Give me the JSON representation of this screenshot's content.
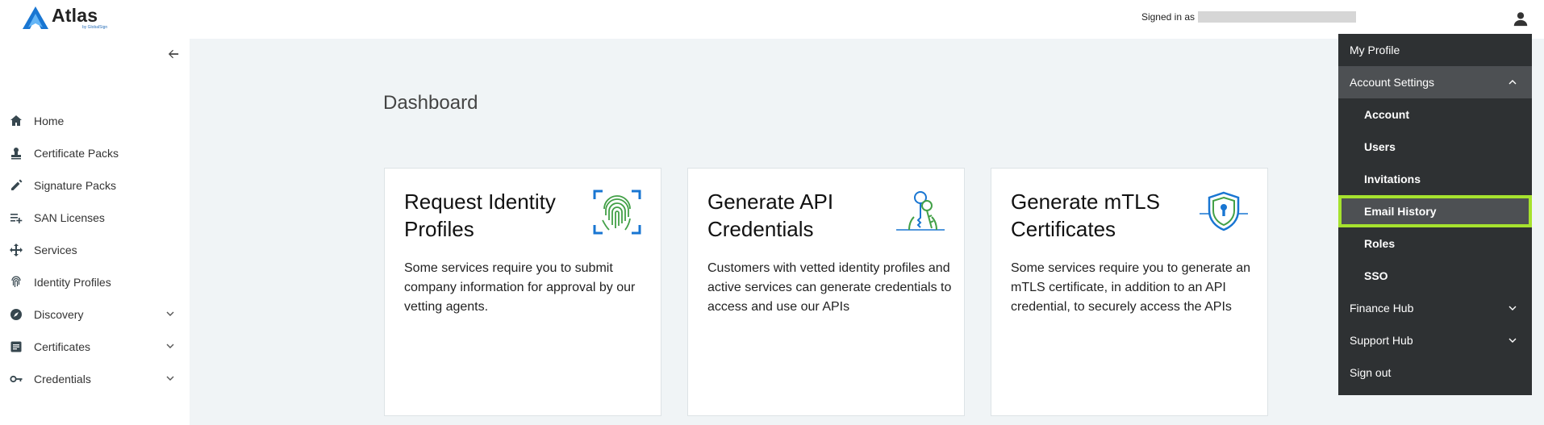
{
  "header": {
    "logo_text": "Atlas",
    "logo_sub": "by GlobalSign",
    "signed_in_label": "Signed in as"
  },
  "sidebar": {
    "items": [
      {
        "label": "Home",
        "icon": "home-icon"
      },
      {
        "label": "Certificate Packs",
        "icon": "stamp-icon"
      },
      {
        "label": "Signature Packs",
        "icon": "pen-icon"
      },
      {
        "label": "SAN Licenses",
        "icon": "list-add-icon"
      },
      {
        "label": "Services",
        "icon": "arrows-move-icon"
      },
      {
        "label": "Identity Profiles",
        "icon": "fingerprint-icon"
      },
      {
        "label": "Discovery",
        "icon": "compass-icon"
      },
      {
        "label": "Certificates",
        "icon": "document-icon"
      },
      {
        "label": "Credentials",
        "icon": "key-icon"
      }
    ]
  },
  "main": {
    "title": "Dashboard",
    "cards": [
      {
        "title": "Request Identity Profiles",
        "body": "Some services require you to submit company information for approval by our vetting agents.",
        "icon": "fingerprint-scan-icon"
      },
      {
        "title": "Generate API Credentials",
        "body": "Customers with vetted identity profiles and active services can generate credentials to access and use our APIs",
        "icon": "keys-icon"
      },
      {
        "title": "Generate mTLS Certificates",
        "body": "Some services require you to generate an mTLS certificate, in addition to an API credential, to securely access the APIs",
        "icon": "shield-lock-icon"
      }
    ]
  },
  "menu": {
    "my_profile": "My Profile",
    "account_settings": "Account Settings",
    "account": "Account",
    "users": "Users",
    "invitations": "Invitations",
    "email_history": "Email History",
    "roles": "Roles",
    "sso": "SSO",
    "finance_hub": "Finance Hub",
    "support_hub": "Support Hub",
    "sign_out": "Sign out"
  },
  "colors": {
    "accent_blue": "#1976d2",
    "menu_bg": "#2e3133",
    "highlight": "#a6e22e",
    "main_bg": "#f0f4f6"
  }
}
